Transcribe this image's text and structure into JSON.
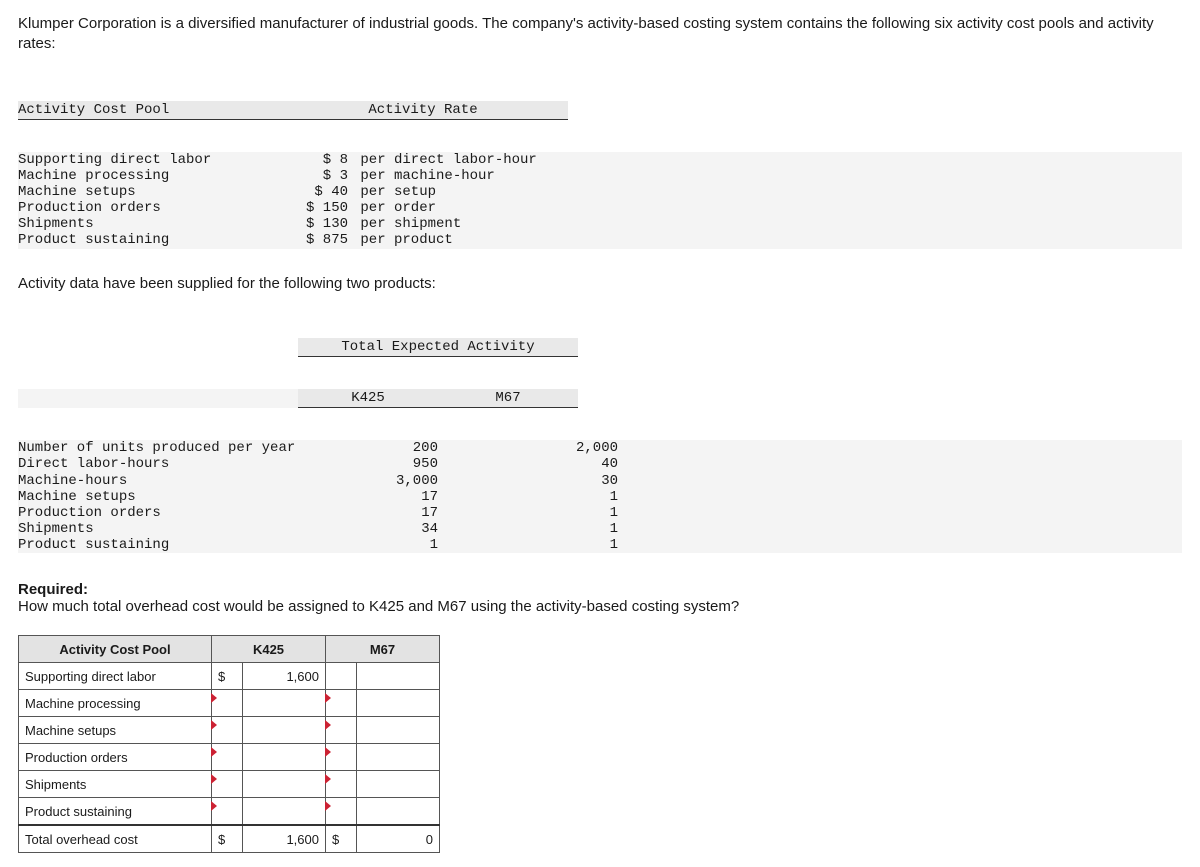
{
  "intro": "Klumper Corporation is a diversified manufacturer of industrial goods. The company's activity-based costing system contains the following six activity cost pools and activity rates:",
  "rate_table": {
    "headers": {
      "pool": "Activity Cost Pool",
      "rate": "Activity Rate"
    },
    "rows": [
      {
        "pool": "Supporting direct labor",
        "amt": "$ 8",
        "unit": "per direct labor-hour"
      },
      {
        "pool": "Machine processing",
        "amt": "$ 3",
        "unit": "per machine-hour"
      },
      {
        "pool": "Machine setups",
        "amt": "$ 40",
        "unit": "per setup"
      },
      {
        "pool": "Production orders",
        "amt": "$ 150",
        "unit": "per order"
      },
      {
        "pool": "Shipments",
        "amt": "$ 130",
        "unit": "per shipment"
      },
      {
        "pool": "Product sustaining",
        "amt": "$ 875",
        "unit": "per product"
      }
    ]
  },
  "mid": "Activity data have been supplied for the following two products:",
  "activity_table": {
    "header": "Total Expected Activity",
    "cols": [
      "K425",
      "M67"
    ],
    "rows": [
      {
        "lbl": "Number of units produced per year",
        "k": "200",
        "m": "2,000"
      },
      {
        "lbl": "Direct labor-hours",
        "k": "950",
        "m": "40"
      },
      {
        "lbl": "Machine-hours",
        "k": "3,000",
        "m": "30"
      },
      {
        "lbl": "Machine setups",
        "k": "17",
        "m": "1"
      },
      {
        "lbl": "Production orders",
        "k": "17",
        "m": "1"
      },
      {
        "lbl": "Shipments",
        "k": "34",
        "m": "1"
      },
      {
        "lbl": "Product sustaining",
        "k": "1",
        "m": "1"
      }
    ]
  },
  "required_label": "Required:",
  "required_text": "How much total overhead cost would be assigned to K425 and M67 using the activity-based costing system?",
  "input_table": {
    "headers": [
      "Activity Cost Pool",
      "K425",
      "M67"
    ],
    "rows": [
      {
        "label": "Supporting direct labor",
        "k_sym": "$",
        "k_val": "1,600",
        "m_sym": "",
        "m_val": ""
      },
      {
        "label": "Machine processing",
        "k_sym": "",
        "k_val": "",
        "m_sym": "",
        "m_val": ""
      },
      {
        "label": "Machine setups",
        "k_sym": "",
        "k_val": "",
        "m_sym": "",
        "m_val": ""
      },
      {
        "label": "Production orders",
        "k_sym": "",
        "k_val": "",
        "m_sym": "",
        "m_val": ""
      },
      {
        "label": "Shipments",
        "k_sym": "",
        "k_val": "",
        "m_sym": "",
        "m_val": ""
      },
      {
        "label": "Product sustaining",
        "k_sym": "",
        "k_val": "",
        "m_sym": "",
        "m_val": ""
      }
    ],
    "total": {
      "label": "Total overhead cost",
      "k_sym": "$",
      "k_val": "1,600",
      "m_sym": "$",
      "m_val": "0"
    }
  }
}
